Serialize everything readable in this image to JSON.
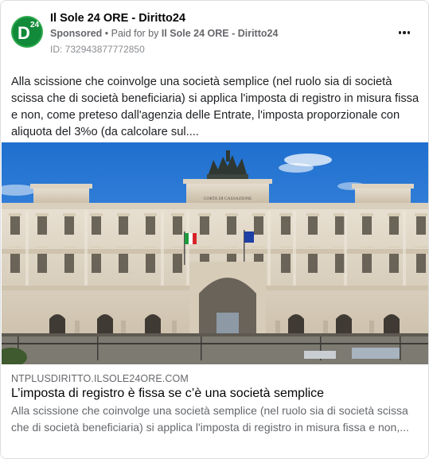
{
  "page": {
    "name": "Il Sole 24 ORE - Diritto24",
    "avatar_letter": "D",
    "avatar_number": "24"
  },
  "meta": {
    "sponsored": "Sponsored",
    "separator": " • ",
    "paid_for_by": "Paid for by ",
    "payer": "Il Sole 24 ORE - Diritto24",
    "id_text": "ID: 732943877772850"
  },
  "post": {
    "text": "Alla scissione che coinvolge una società semplice (nel ruolo sia di società scissa che di società beneficiaria) si applica l'imposta di registro in misura fissa e non, come preteso dall'agenzia delle Entrate, l'imposta proporzionale con aliquota del 3%o (da calcolare sul...."
  },
  "image": {
    "inscription": "CORTE DI CASSAZIONE"
  },
  "link": {
    "domain": "NTPLUSDIRITTO.ILSOLE24ORE.COM",
    "title": "L’imposta di registro è fissa se c’è una società semplice",
    "description": "Alla scissione che coinvolge una società semplice (nel ruolo sia di società scissa che di società beneficiaria) si applica l'imposta di registro in misura fissa e non,..."
  },
  "icons": {
    "more": "more-options-icon",
    "avatar": "diritto24-logo"
  },
  "colors": {
    "brand_green": "#118a3a",
    "meta_gray": "#65676b",
    "sky": "#2f7fd6"
  }
}
